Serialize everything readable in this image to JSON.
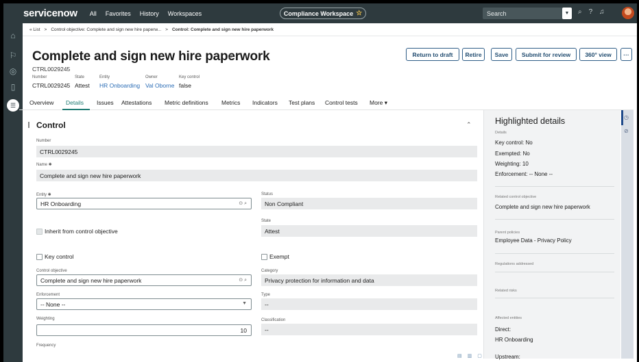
{
  "topbar": {
    "logo": "servicenow",
    "nav": [
      "All",
      "Favorites",
      "History",
      "Workspaces"
    ],
    "workspace_label": "Compliance Workspace",
    "search_placeholder": "Search"
  },
  "breadcrumb": {
    "root": "« List",
    "sep1": ">",
    "item1": "Control objective: Complete and sign new hire paperw...",
    "sep2": ">",
    "current": "Control: Complete and sign new hire paperwork"
  },
  "header": {
    "title": "Complete and sign new hire paperwork",
    "number": "CTRL0029245",
    "meta": [
      {
        "label": "Number",
        "value": "CTRL0029245"
      },
      {
        "label": "State",
        "value": "Attest"
      },
      {
        "label": "Entity",
        "value": "HR Onboarding"
      },
      {
        "label": "Owner",
        "value": "Val Oborne"
      },
      {
        "label": "Key control",
        "value": "false"
      }
    ],
    "buttons": [
      "Return to draft",
      "Retire",
      "Save",
      "Submit for review",
      "360° view",
      "···"
    ]
  },
  "tabs": [
    "Overview",
    "Details",
    "Issues",
    "Attestations",
    "Metric definitions",
    "Metrics",
    "Indicators",
    "Test plans",
    "Control tests",
    "More ▾"
  ],
  "active_tab": "Details",
  "section": {
    "title": "Control",
    "fields": {
      "number_label": "Number",
      "number_value": "CTRL0029245",
      "name_label": "Name ✱",
      "name_value": "Complete and sign new hire paperwork",
      "entity_label": "Entity ✱",
      "entity_value": "HR Onboarding",
      "status_label": "Status",
      "status_value": "Non Compliant",
      "state_label": "State",
      "state_value": "Attest",
      "inherit_label": "Inherit from control objective",
      "key_control_label": "Key control",
      "exempt_label": "Exempt",
      "control_objective_label": "Control objective",
      "control_objective_value": "Complete and sign new hire paperwork",
      "category_label": "Category",
      "category_value": "Privacy protection for information and data",
      "enforcement_label": "Enforcement",
      "enforcement_value": "-- None --",
      "type_label": "Type",
      "type_value": "--",
      "weighting_label": "Weighting",
      "weighting_value": "10",
      "classification_label": "Classification",
      "classification_value": "--",
      "frequency_label": "Frequency"
    }
  },
  "highlighted": {
    "title": "Highlighted details",
    "details_label": "Details",
    "key_control": "Key control: No",
    "exempted": "Exempted: No",
    "weighting": "Weighting: 10",
    "enforcement": "Enforcement: -- None --",
    "related_objective_label": "Related control objective",
    "related_objective_value": "Complete and sign new hire paperwork",
    "parent_policies_label": "Parent policies",
    "parent_policies_value": "Employee Data - Privacy Policy",
    "regulations_label": "Regulations addressed",
    "related_risks_label": "Related risks",
    "affected_label": "Affected entities",
    "direct_label": "Direct:",
    "direct_value": "HR Onboarding",
    "upstream_label": "Upstream:"
  },
  "colors": {
    "topbar": "#2e3a3e",
    "accent": "#1e7a72",
    "button_border": "#2e5d87",
    "link": "#2a6cb5"
  }
}
